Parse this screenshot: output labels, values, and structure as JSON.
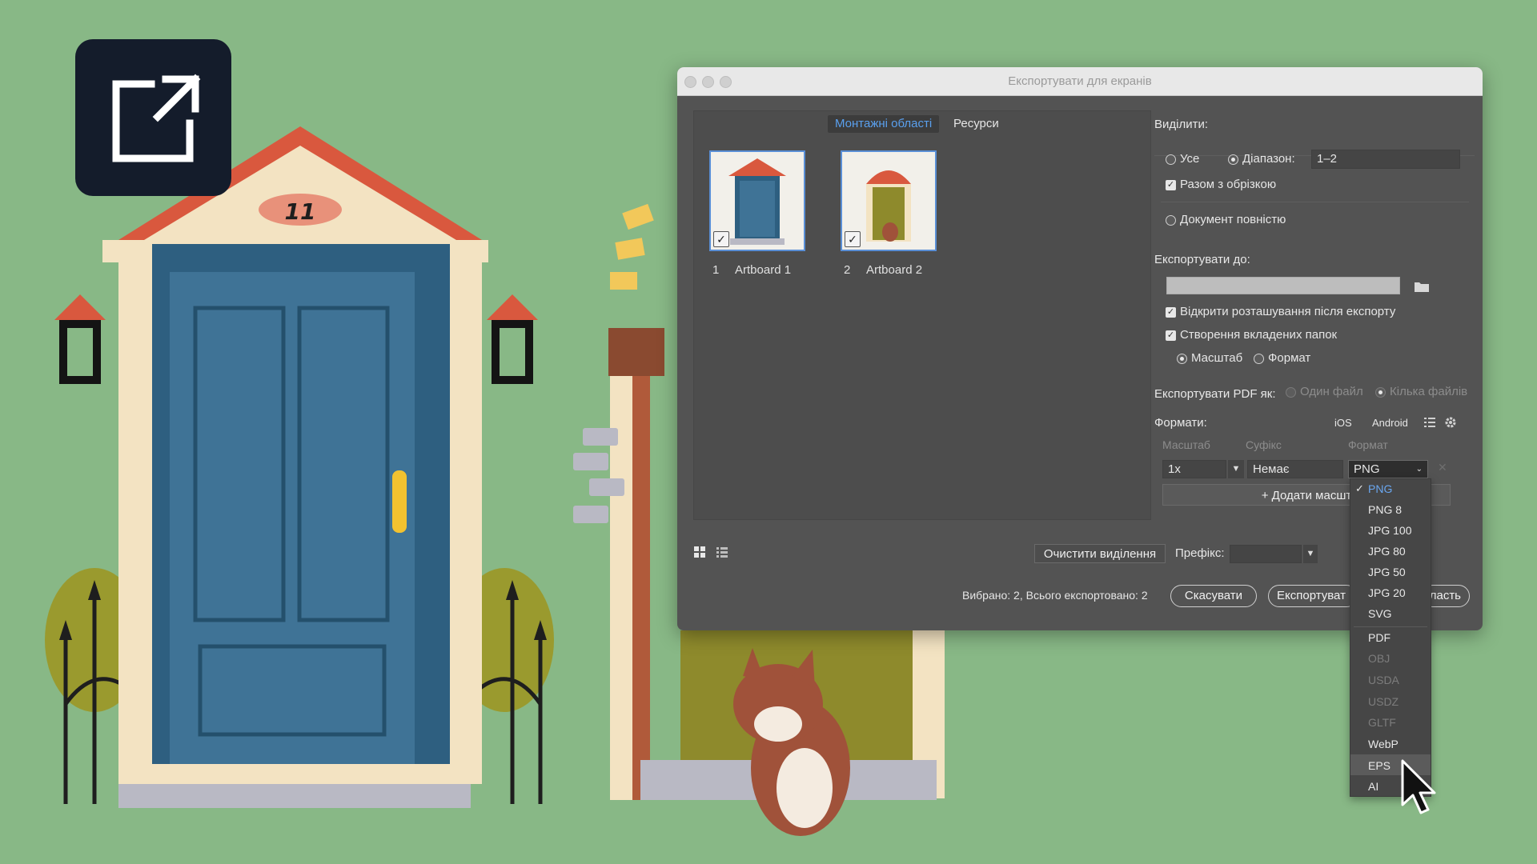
{
  "dialog": {
    "title": "Експортувати для екранів",
    "tabs": [
      "Монтажні області",
      "Ресурси"
    ],
    "artboards": [
      {
        "number": "1",
        "name": "Artboard 1"
      },
      {
        "number": "2",
        "name": "Artboard 2"
      }
    ],
    "select": {
      "heading": "Виділити:",
      "all_label": "Усе",
      "range_label": "Діапазон:",
      "range_value": "1–2",
      "bleed_label": "Разом з обрізкою",
      "full_doc_label": "Документ повністю"
    },
    "export_to": {
      "heading": "Експортувати до:",
      "open_location_label": "Відкрити розташування після експорту",
      "subfolders_label": "Створення вкладених папок",
      "scale_label": "Масштаб",
      "format_label": "Формат"
    },
    "pdf": {
      "heading": "Експортувати PDF як:",
      "single_label": "Один файл",
      "multi_label": "Кілька файлів"
    },
    "formats": {
      "heading": "Формати:",
      "ios_label": "iOS",
      "android_label": "Android",
      "col_scale": "Масштаб",
      "col_suffix": "Суфікс",
      "col_format": "Формат",
      "scale_value": "1x",
      "suffix_placeholder": "Немає",
      "format_value": "PNG",
      "add_scale_label": "+ Додати масшт"
    },
    "bottom": {
      "clear_selection": "Очистити виділення",
      "prefix_label": "Префікс:",
      "status": "Вибрано: 2, Всього експортовано: 2",
      "cancel": "Скасувати",
      "export": "Експортуват",
      "artboard_tail": "ласть"
    },
    "format_menu": [
      {
        "label": "PNG",
        "selected": true,
        "enabled": true
      },
      {
        "label": "PNG 8",
        "enabled": true
      },
      {
        "label": "JPG 100",
        "enabled": true
      },
      {
        "label": "JPG 80",
        "enabled": true
      },
      {
        "label": "JPG 50",
        "enabled": true
      },
      {
        "label": "JPG 20",
        "enabled": true
      },
      {
        "label": "SVG",
        "enabled": true
      },
      {
        "label": "PDF",
        "enabled": true
      },
      {
        "label": "OBJ",
        "enabled": false
      },
      {
        "label": "USDA",
        "enabled": false
      },
      {
        "label": "USDZ",
        "enabled": false
      },
      {
        "label": "GLTF",
        "enabled": false
      },
      {
        "label": "WebP",
        "enabled": true
      },
      {
        "label": "EPS",
        "enabled": true
      },
      {
        "label": "AI",
        "enabled": true
      }
    ]
  },
  "illustration": {
    "house_number": "11"
  },
  "colors": {
    "background": "#88b886",
    "door_blue": "#3f7396",
    "door_olive": "#8e8a2c",
    "roof_red": "#d9583e",
    "accent_blue": "#5a8fd6"
  }
}
